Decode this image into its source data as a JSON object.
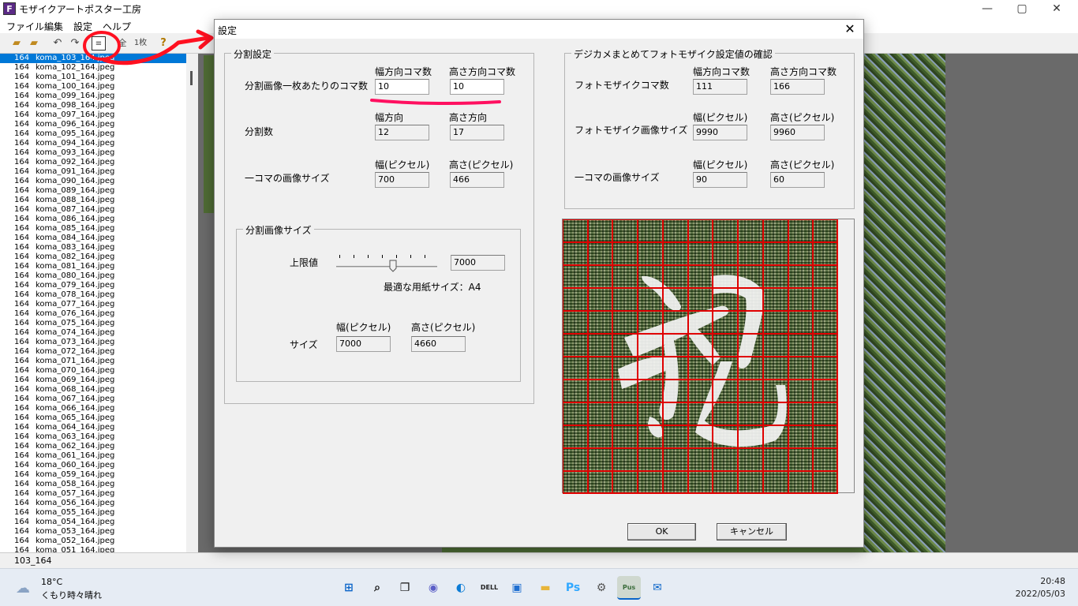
{
  "app": {
    "title": "モザイクアートポスター工房",
    "icon_letter": "F",
    "menus": [
      "ファイル",
      "編集",
      "設定",
      "ヘルプ"
    ],
    "window_controls": [
      "—",
      "▢",
      "✕"
    ]
  },
  "toolbar": {
    "icons": [
      "open-folder-icon",
      "new-folder-icon",
      "undo-icon",
      "redo-icon",
      "settings-dialog-icon",
      "all-icon",
      "one-sheet-icon",
      "help-icon"
    ],
    "all_label": "全",
    "one_label": "1枚",
    "help_label": "?"
  },
  "filelist": {
    "rows": [
      {
        "n": "164",
        "f": "koma_103_164.jpeg",
        "sel": true
      },
      {
        "n": "164",
        "f": "koma_102_164.jpeg"
      },
      {
        "n": "164",
        "f": "koma_101_164.jpeg"
      },
      {
        "n": "164",
        "f": "koma_100_164.jpeg"
      },
      {
        "n": "164",
        "f": "koma_099_164.jpeg"
      },
      {
        "n": "164",
        "f": "koma_098_164.jpeg"
      },
      {
        "n": "164",
        "f": "koma_097_164.jpeg"
      },
      {
        "n": "164",
        "f": "koma_096_164.jpeg"
      },
      {
        "n": "164",
        "f": "koma_095_164.jpeg"
      },
      {
        "n": "164",
        "f": "koma_094_164.jpeg"
      },
      {
        "n": "164",
        "f": "koma_093_164.jpeg"
      },
      {
        "n": "164",
        "f": "koma_092_164.jpeg"
      },
      {
        "n": "164",
        "f": "koma_091_164.jpeg"
      },
      {
        "n": "164",
        "f": "koma_090_164.jpeg"
      },
      {
        "n": "164",
        "f": "koma_089_164.jpeg"
      },
      {
        "n": "164",
        "f": "koma_088_164.jpeg"
      },
      {
        "n": "164",
        "f": "koma_087_164.jpeg"
      },
      {
        "n": "164",
        "f": "koma_086_164.jpeg"
      },
      {
        "n": "164",
        "f": "koma_085_164.jpeg"
      },
      {
        "n": "164",
        "f": "koma_084_164.jpeg"
      },
      {
        "n": "164",
        "f": "koma_083_164.jpeg"
      },
      {
        "n": "164",
        "f": "koma_082_164.jpeg"
      },
      {
        "n": "164",
        "f": "koma_081_164.jpeg"
      },
      {
        "n": "164",
        "f": "koma_080_164.jpeg"
      },
      {
        "n": "164",
        "f": "koma_079_164.jpeg"
      },
      {
        "n": "164",
        "f": "koma_078_164.jpeg"
      },
      {
        "n": "164",
        "f": "koma_077_164.jpeg"
      },
      {
        "n": "164",
        "f": "koma_076_164.jpeg"
      },
      {
        "n": "164",
        "f": "koma_075_164.jpeg"
      },
      {
        "n": "164",
        "f": "koma_074_164.jpeg"
      },
      {
        "n": "164",
        "f": "koma_073_164.jpeg"
      },
      {
        "n": "164",
        "f": "koma_072_164.jpeg"
      },
      {
        "n": "164",
        "f": "koma_071_164.jpeg"
      },
      {
        "n": "164",
        "f": "koma_070_164.jpeg"
      },
      {
        "n": "164",
        "f": "koma_069_164.jpeg"
      },
      {
        "n": "164",
        "f": "koma_068_164.jpeg"
      },
      {
        "n": "164",
        "f": "koma_067_164.jpeg"
      },
      {
        "n": "164",
        "f": "koma_066_164.jpeg"
      },
      {
        "n": "164",
        "f": "koma_065_164.jpeg"
      },
      {
        "n": "164",
        "f": "koma_064_164.jpeg"
      },
      {
        "n": "164",
        "f": "koma_063_164.jpeg"
      },
      {
        "n": "164",
        "f": "koma_062_164.jpeg"
      },
      {
        "n": "164",
        "f": "koma_061_164.jpeg"
      },
      {
        "n": "164",
        "f": "koma_060_164.jpeg"
      },
      {
        "n": "164",
        "f": "koma_059_164.jpeg"
      },
      {
        "n": "164",
        "f": "koma_058_164.jpeg"
      },
      {
        "n": "164",
        "f": "koma_057_164.jpeg"
      },
      {
        "n": "164",
        "f": "koma_056_164.jpeg"
      },
      {
        "n": "164",
        "f": "koma_055_164.jpeg"
      },
      {
        "n": "164",
        "f": "koma_054_164.jpeg"
      },
      {
        "n": "164",
        "f": "koma_053_164.jpeg"
      },
      {
        "n": "164",
        "f": "koma_052_164.jpeg"
      },
      {
        "n": "164",
        "f": "koma_051_164.jpeg"
      }
    ]
  },
  "status": {
    "text": "103_164"
  },
  "dialog": {
    "title": "設定",
    "close": "✕",
    "split": {
      "group_label": "分割設定",
      "per_sheet_label": "分割画像一枚あたりのコマ数",
      "per_sheet_h_header": "幅方向コマ数",
      "per_sheet_v_header": "高さ方向コマ数",
      "per_sheet_h": "10",
      "per_sheet_v": "10",
      "count_label": "分割数",
      "count_h_header": "幅方向",
      "count_v_header": "高さ方向",
      "count_h": "12",
      "count_v": "17",
      "cell_label": "一コマの画像サイズ",
      "cell_w_header": "幅(ピクセル)",
      "cell_h_header": "高さ(ピクセル)",
      "cell_w": "700",
      "cell_h": "466"
    },
    "size": {
      "group_label": "分割画像サイズ",
      "limit_label": "上限値",
      "limit_value": "7000",
      "paper_label": "最適な用紙サイズ：A4",
      "size_label": "サイズ",
      "w_header": "幅(ピクセル)",
      "h_header": "高さ(ピクセル)",
      "w": "7000",
      "h": "4660"
    },
    "confirm": {
      "group_label": "デジカメまとめてフォトモザイク設定値の確認",
      "koma_label": "フォトモザイクコマ数",
      "koma_h_header": "幅方向コマ数",
      "koma_v_header": "高さ方向コマ数",
      "koma_h": "111",
      "koma_v": "166",
      "img_label": "フォトモザイク画像サイズ",
      "img_w_header": "幅(ピクセル)",
      "img_h_header": "高さ(ピクセル)",
      "img_w": "9990",
      "img_h": "9960",
      "cell_label": "一コマの画像サイズ",
      "cell_w_header": "幅(ピクセル)",
      "cell_h_header": "高さ(ピクセル)",
      "cell_w": "90",
      "cell_h": "60"
    },
    "preview": {
      "grid_cols": 11,
      "grid_rows": 12,
      "grid_color": "#e00000"
    },
    "ok": "OK",
    "cancel": "キャンセル"
  },
  "taskbar": {
    "weather_temp": "18°C",
    "weather_desc": "くもり時々晴れ",
    "apps": [
      {
        "name": "start-icon",
        "glyph": "⊞",
        "color": "#0a64c8"
      },
      {
        "name": "search-icon",
        "glyph": "⌕",
        "color": "#111"
      },
      {
        "name": "task-view-icon",
        "glyph": "❐",
        "color": "#111"
      },
      {
        "name": "chat-icon",
        "glyph": "◉",
        "color": "#5b5fc7"
      },
      {
        "name": "edge-icon",
        "glyph": "◐",
        "color": "#0c7cd5"
      },
      {
        "name": "dell-icon",
        "glyph": "DELL",
        "color": "#222"
      },
      {
        "name": "store-icon",
        "glyph": "▣",
        "color": "#1f6fd1"
      },
      {
        "name": "explorer-icon",
        "glyph": "▬",
        "color": "#e8b53a"
      },
      {
        "name": "photoshop-icon",
        "glyph": "Ps",
        "color": "#31a8ff"
      },
      {
        "name": "settings-icon",
        "glyph": "⚙",
        "color": "#555"
      },
      {
        "name": "poster-app-icon",
        "glyph": "Pus",
        "color": "#3a6b3a"
      },
      {
        "name": "mail-icon",
        "glyph": "✉",
        "color": "#0a64c8"
      }
    ],
    "time": "20:48",
    "date": "2022/05/03"
  }
}
